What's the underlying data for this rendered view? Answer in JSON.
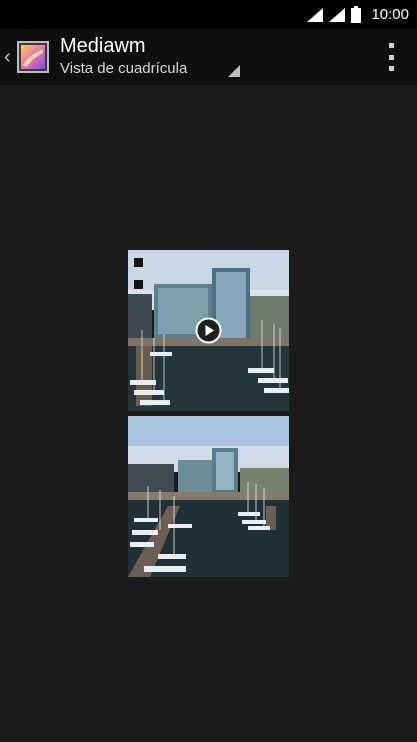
{
  "status_bar": {
    "time": "10:00",
    "icons": [
      "wifi-icon",
      "signal-icon",
      "battery-icon"
    ]
  },
  "action_bar": {
    "title": "Mediawm",
    "view_mode": "Vista de cuadrícula",
    "icons": [
      "back-chevron-icon",
      "gallery-app-icon",
      "spinner-triangle-icon",
      "overflow-menu-icon"
    ]
  },
  "grid": {
    "items": [
      {
        "kind": "video",
        "icon": "play-icon"
      },
      {
        "kind": "photo"
      }
    ]
  },
  "colors": {
    "background": "#1b1b1b",
    "action_bar": "#0f0f0f",
    "status_bar": "#000000"
  }
}
